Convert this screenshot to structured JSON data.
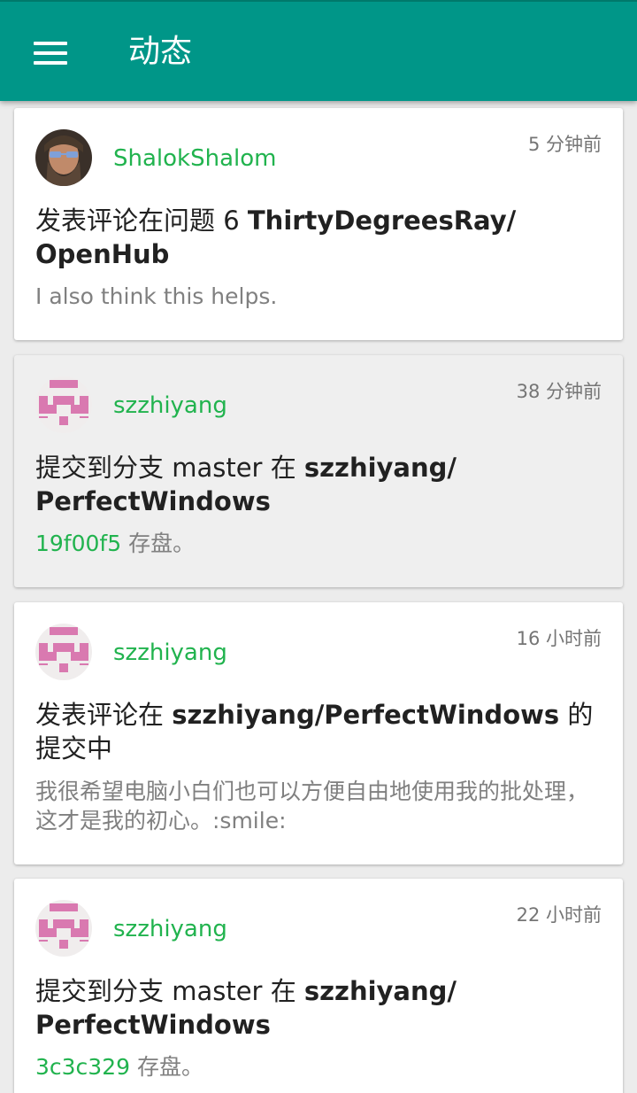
{
  "appbar": {
    "title": "动态"
  },
  "feed": [
    {
      "user": "ShalokShalom",
      "time": "5 分钟前",
      "action_prefix": "发表评论在问题 6 ",
      "repo": "ThirtyDegreesRay/ OpenHub",
      "action_suffix": "",
      "body": "I also think this helps."
    },
    {
      "user": "szzhiyang",
      "time": "38 分钟前",
      "action_prefix": "提交到分支 master 在 ",
      "repo": "szzhiyang/ PerfectWindows",
      "action_suffix": "",
      "sha": "19f00f5",
      "body": " 存盘。"
    },
    {
      "user": "szzhiyang",
      "time": "16 小时前",
      "action_prefix": "发表评论在 ",
      "repo": "szzhiyang/PerfectWindows",
      "action_suffix": " 的提交中",
      "body": "我很希望电脑小白们也可以方便自由地使用我的批处理，这才是我的初心。:smile:"
    },
    {
      "user": "szzhiyang",
      "time": "22 小时前",
      "action_prefix": "提交到分支 master 在 ",
      "repo": "szzhiyang/ PerfectWindows",
      "action_suffix": "",
      "sha": "3c3c329",
      "body": " 存盘。"
    }
  ]
}
